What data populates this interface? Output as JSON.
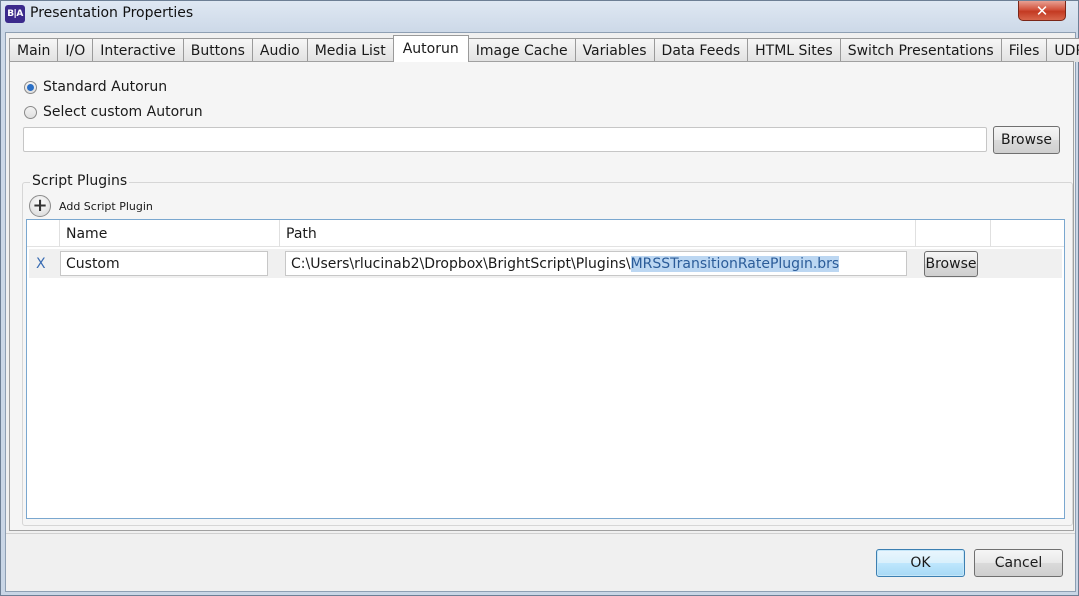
{
  "window": {
    "title": "Presentation Properties",
    "app_icon_text": "B|A",
    "close_glyph": "✕"
  },
  "tabs": [
    {
      "label": "Main"
    },
    {
      "label": "I/O"
    },
    {
      "label": "Interactive"
    },
    {
      "label": "Buttons"
    },
    {
      "label": "Audio"
    },
    {
      "label": "Media List"
    },
    {
      "label": "Autorun",
      "active": true
    },
    {
      "label": "Image Cache"
    },
    {
      "label": "Variables"
    },
    {
      "label": "Data Feeds"
    },
    {
      "label": "HTML Sites"
    },
    {
      "label": "Switch Presentations"
    },
    {
      "label": "Files"
    },
    {
      "label": "UDP"
    }
  ],
  "autorun": {
    "standard_label": "Standard Autorun",
    "custom_label": "Select custom Autorun",
    "selected": "standard",
    "custom_path_value": "",
    "browse_label": "Browse"
  },
  "plugins": {
    "group_label": "Script Plugins",
    "add_label": "Add Script Plugin",
    "columns": {
      "name": "Name",
      "path": "Path"
    },
    "rows": [
      {
        "remove": "X",
        "name": "Custom",
        "path_prefix": "C:\\Users\\rlucinab2\\Dropbox\\BrightScript\\Plugins\\",
        "path_selected": "MRSSTransitionRatePlugin.brs",
        "browse_label": "Browse"
      }
    ]
  },
  "footer": {
    "ok_label": "OK",
    "cancel_label": "Cancel"
  },
  "colors": {
    "accent": "#3c7fb1",
    "selection": "#bcd7f2",
    "close_red": "#c33a22"
  }
}
